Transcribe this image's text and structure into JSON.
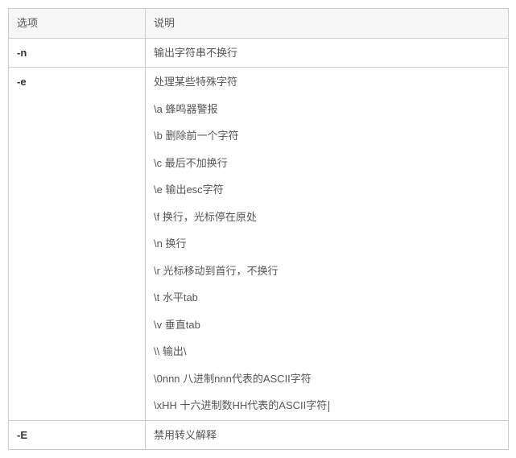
{
  "headers": {
    "option": "选项",
    "description": "说明"
  },
  "rows": [
    {
      "option": "-n",
      "desc_plain": "输出字符串不换行"
    },
    {
      "option": "-e",
      "desc_intro": "处理某些特殊字符",
      "esc_items": [
        "\\a 蜂鸣器警报",
        "\\b 删除前一个字符",
        "\\c 最后不加换行",
        "\\e 输出esc字符",
        "\\f 换行，光标停在原处",
        "\\n 换行",
        "\\r 光标移动到首行，不换行",
        "\\t 水平tab",
        "\\v 垂直tab",
        "\\\\ 输出\\",
        "\\0nnn 八进制nnn代表的ASCII字符",
        "\\xHH 十六进制数HH代表的ASCII字符"
      ]
    },
    {
      "option": "-E",
      "desc_plain": "禁用转义解释"
    }
  ]
}
